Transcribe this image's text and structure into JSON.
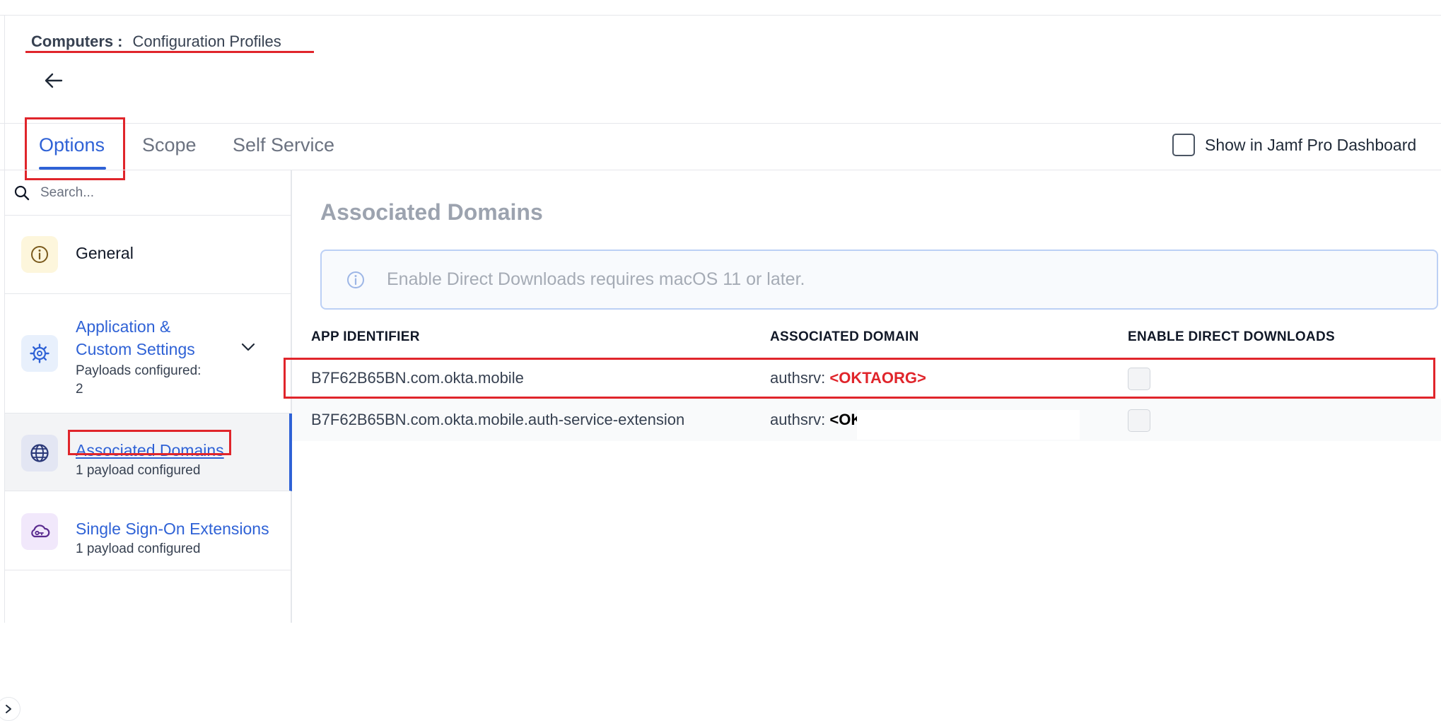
{
  "breadcrumb": {
    "section": "Computers",
    "separator": ":",
    "page": "Configuration Profiles"
  },
  "back": {
    "icon": "arrow-left-icon"
  },
  "tabs": [
    {
      "label": "Options",
      "active": true
    },
    {
      "label": "Scope",
      "active": false
    },
    {
      "label": "Self Service",
      "active": false
    }
  ],
  "dashboard": {
    "label": "Show in Jamf Pro Dashboard",
    "checked": false
  },
  "sidebar": {
    "search_placeholder": "Search...",
    "items": [
      {
        "title_lines": [
          "General"
        ],
        "subtitle": "",
        "icon": "info-icon",
        "icon_bg": "#fdf6dc",
        "active": false
      },
      {
        "title_lines": [
          "Application &",
          "Custom Settings"
        ],
        "subtitle_lines": [
          "Payloads configured:",
          "2"
        ],
        "icon": "gear-icon",
        "icon_bg": "#e8f0fc",
        "active": false
      },
      {
        "title_lines": [
          "Associated Domains"
        ],
        "subtitle": "1 payload configured",
        "icon": "globe-icon",
        "icon_bg": "#e3e6f3",
        "active": true
      },
      {
        "title_lines": [
          "Single Sign-On Extensions"
        ],
        "subtitle": "1 payload configured",
        "icon": "cloud-key-icon",
        "icon_bg": "#f1e8fb",
        "active": false
      }
    ]
  },
  "main": {
    "title": "Associated Domains",
    "banner": "Enable Direct Downloads requires macOS 11 or later.",
    "columns": [
      "APP IDENTIFIER",
      "ASSOCIATED DOMAIN",
      "ENABLE DIRECT DOWNLOADS"
    ],
    "rows": [
      {
        "app_id": "B7F62B65BN.com.okta.mobile",
        "domain_prefix": "authsrv:",
        "domain_value": "<OKTAORG>",
        "enable_direct_downloads": false
      },
      {
        "app_id": "B7F62B65BN.com.okta.mobile.auth-service-extension",
        "domain_prefix": "authsrv:",
        "domain_value": "<OKTAORG>",
        "enable_direct_downloads": false
      }
    ]
  },
  "colors": {
    "accent": "#2f62d6",
    "highlight": "#e0252b",
    "muted_title": "#9ca3af"
  }
}
